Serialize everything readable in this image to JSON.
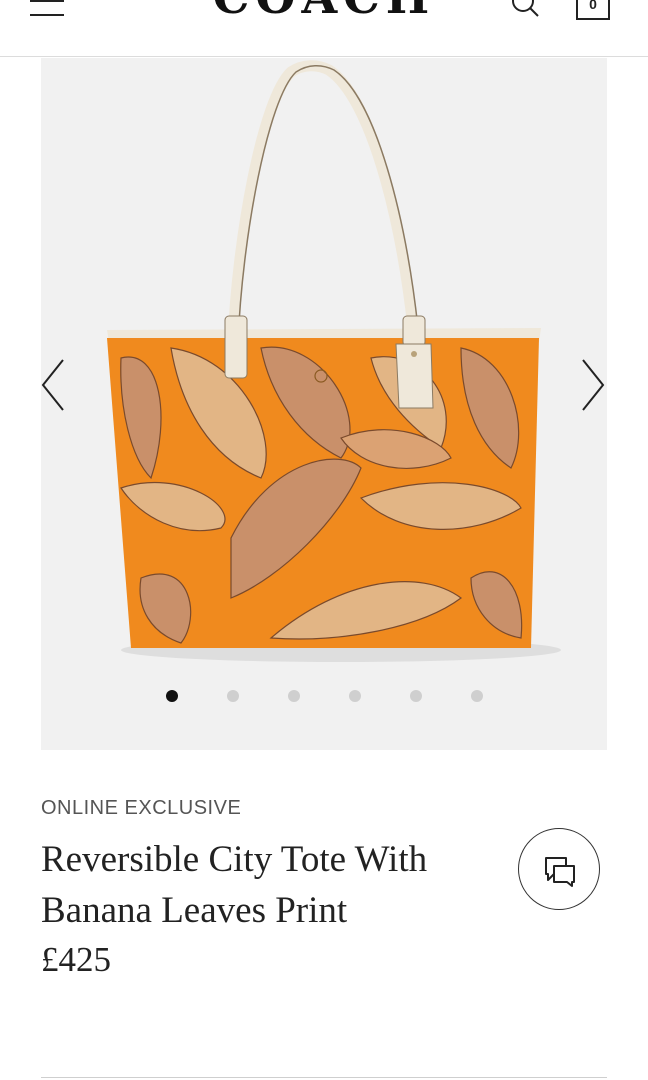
{
  "header": {
    "logo": "COACH",
    "bag_count": "0",
    "menu_icon": "hamburger-icon",
    "search_icon": "search-icon",
    "bag_icon": "shopping-bag-icon"
  },
  "gallery": {
    "image_count": 6,
    "active_index": 0,
    "prev_icon": "chevron-left-icon",
    "next_icon": "chevron-right-icon"
  },
  "product": {
    "badge": "ONLINE EXCLUSIVE",
    "title": "Reversible City Tote With Banana Leaves Print",
    "price": "£425"
  },
  "chat": {
    "icon": "chat-bubbles-icon"
  },
  "colors": {
    "accent": "#f08a1e",
    "leaf": "#c08a5a",
    "gallery_bg": "#f1f1f1"
  }
}
